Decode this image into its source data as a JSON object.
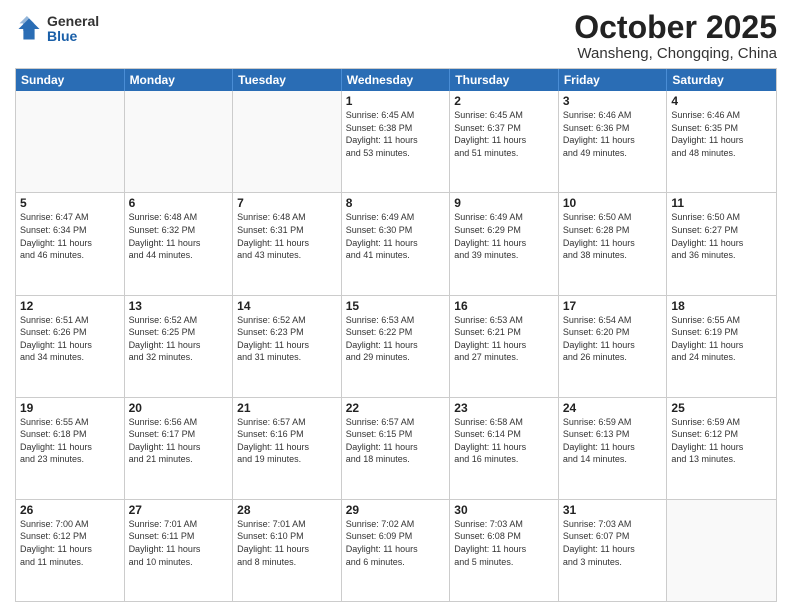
{
  "logo": {
    "general": "General",
    "blue": "Blue"
  },
  "title": "October 2025",
  "subtitle": "Wansheng, Chongqing, China",
  "headers": [
    "Sunday",
    "Monday",
    "Tuesday",
    "Wednesday",
    "Thursday",
    "Friday",
    "Saturday"
  ],
  "weeks": [
    [
      {
        "day": "",
        "info": "",
        "empty": true
      },
      {
        "day": "",
        "info": "",
        "empty": true
      },
      {
        "day": "",
        "info": "",
        "empty": true
      },
      {
        "day": "1",
        "info": "Sunrise: 6:45 AM\nSunset: 6:38 PM\nDaylight: 11 hours\nand 53 minutes."
      },
      {
        "day": "2",
        "info": "Sunrise: 6:45 AM\nSunset: 6:37 PM\nDaylight: 11 hours\nand 51 minutes."
      },
      {
        "day": "3",
        "info": "Sunrise: 6:46 AM\nSunset: 6:36 PM\nDaylight: 11 hours\nand 49 minutes."
      },
      {
        "day": "4",
        "info": "Sunrise: 6:46 AM\nSunset: 6:35 PM\nDaylight: 11 hours\nand 48 minutes."
      }
    ],
    [
      {
        "day": "5",
        "info": "Sunrise: 6:47 AM\nSunset: 6:34 PM\nDaylight: 11 hours\nand 46 minutes."
      },
      {
        "day": "6",
        "info": "Sunrise: 6:48 AM\nSunset: 6:32 PM\nDaylight: 11 hours\nand 44 minutes."
      },
      {
        "day": "7",
        "info": "Sunrise: 6:48 AM\nSunset: 6:31 PM\nDaylight: 11 hours\nand 43 minutes."
      },
      {
        "day": "8",
        "info": "Sunrise: 6:49 AM\nSunset: 6:30 PM\nDaylight: 11 hours\nand 41 minutes."
      },
      {
        "day": "9",
        "info": "Sunrise: 6:49 AM\nSunset: 6:29 PM\nDaylight: 11 hours\nand 39 minutes."
      },
      {
        "day": "10",
        "info": "Sunrise: 6:50 AM\nSunset: 6:28 PM\nDaylight: 11 hours\nand 38 minutes."
      },
      {
        "day": "11",
        "info": "Sunrise: 6:50 AM\nSunset: 6:27 PM\nDaylight: 11 hours\nand 36 minutes."
      }
    ],
    [
      {
        "day": "12",
        "info": "Sunrise: 6:51 AM\nSunset: 6:26 PM\nDaylight: 11 hours\nand 34 minutes."
      },
      {
        "day": "13",
        "info": "Sunrise: 6:52 AM\nSunset: 6:25 PM\nDaylight: 11 hours\nand 32 minutes."
      },
      {
        "day": "14",
        "info": "Sunrise: 6:52 AM\nSunset: 6:23 PM\nDaylight: 11 hours\nand 31 minutes."
      },
      {
        "day": "15",
        "info": "Sunrise: 6:53 AM\nSunset: 6:22 PM\nDaylight: 11 hours\nand 29 minutes."
      },
      {
        "day": "16",
        "info": "Sunrise: 6:53 AM\nSunset: 6:21 PM\nDaylight: 11 hours\nand 27 minutes."
      },
      {
        "day": "17",
        "info": "Sunrise: 6:54 AM\nSunset: 6:20 PM\nDaylight: 11 hours\nand 26 minutes."
      },
      {
        "day": "18",
        "info": "Sunrise: 6:55 AM\nSunset: 6:19 PM\nDaylight: 11 hours\nand 24 minutes."
      }
    ],
    [
      {
        "day": "19",
        "info": "Sunrise: 6:55 AM\nSunset: 6:18 PM\nDaylight: 11 hours\nand 23 minutes."
      },
      {
        "day": "20",
        "info": "Sunrise: 6:56 AM\nSunset: 6:17 PM\nDaylight: 11 hours\nand 21 minutes."
      },
      {
        "day": "21",
        "info": "Sunrise: 6:57 AM\nSunset: 6:16 PM\nDaylight: 11 hours\nand 19 minutes."
      },
      {
        "day": "22",
        "info": "Sunrise: 6:57 AM\nSunset: 6:15 PM\nDaylight: 11 hours\nand 18 minutes."
      },
      {
        "day": "23",
        "info": "Sunrise: 6:58 AM\nSunset: 6:14 PM\nDaylight: 11 hours\nand 16 minutes."
      },
      {
        "day": "24",
        "info": "Sunrise: 6:59 AM\nSunset: 6:13 PM\nDaylight: 11 hours\nand 14 minutes."
      },
      {
        "day": "25",
        "info": "Sunrise: 6:59 AM\nSunset: 6:12 PM\nDaylight: 11 hours\nand 13 minutes."
      }
    ],
    [
      {
        "day": "26",
        "info": "Sunrise: 7:00 AM\nSunset: 6:12 PM\nDaylight: 11 hours\nand 11 minutes."
      },
      {
        "day": "27",
        "info": "Sunrise: 7:01 AM\nSunset: 6:11 PM\nDaylight: 11 hours\nand 10 minutes."
      },
      {
        "day": "28",
        "info": "Sunrise: 7:01 AM\nSunset: 6:10 PM\nDaylight: 11 hours\nand 8 minutes."
      },
      {
        "day": "29",
        "info": "Sunrise: 7:02 AM\nSunset: 6:09 PM\nDaylight: 11 hours\nand 6 minutes."
      },
      {
        "day": "30",
        "info": "Sunrise: 7:03 AM\nSunset: 6:08 PM\nDaylight: 11 hours\nand 5 minutes."
      },
      {
        "day": "31",
        "info": "Sunrise: 7:03 AM\nSunset: 6:07 PM\nDaylight: 11 hours\nand 3 minutes."
      },
      {
        "day": "",
        "info": "",
        "empty": true
      }
    ]
  ]
}
